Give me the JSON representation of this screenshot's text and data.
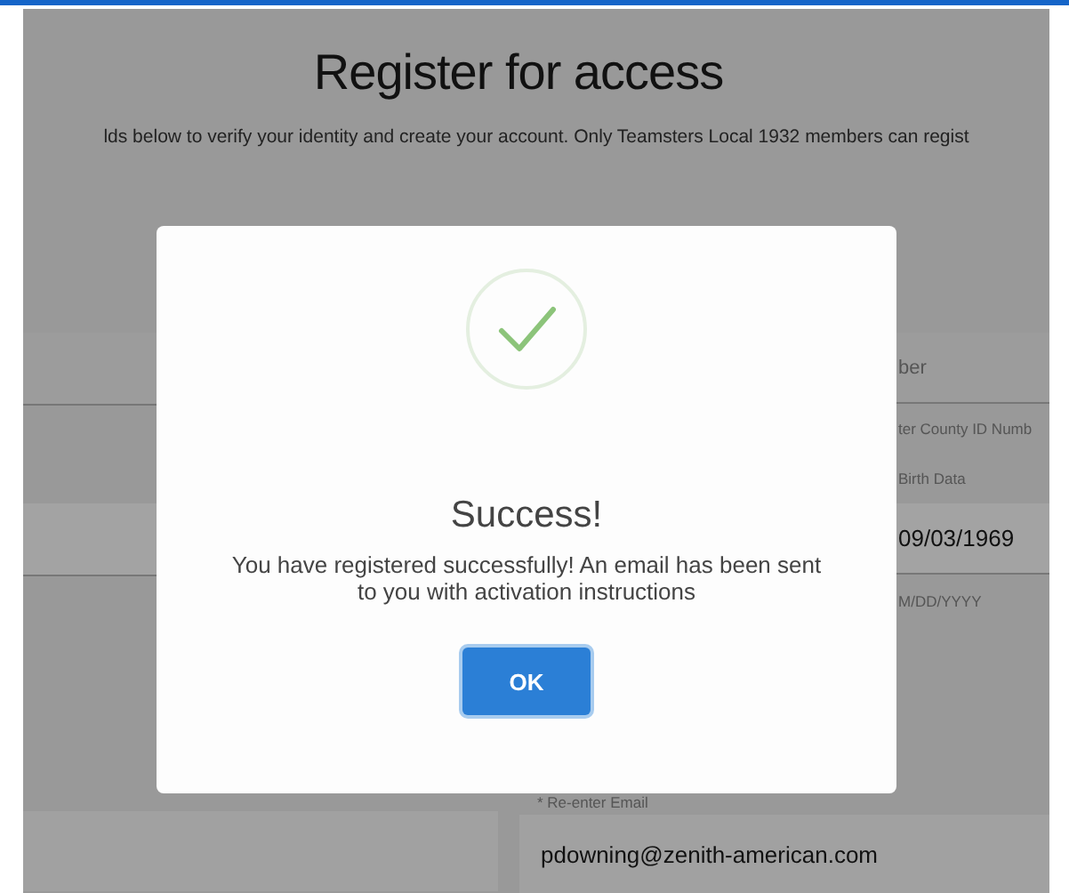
{
  "page": {
    "title": "Register for access",
    "intro": "lds below to verify your identity and create your account. Only Teamsters Local 1932 members can regist"
  },
  "form_right": {
    "section_heading": "ber",
    "hint": "ter County ID Numb",
    "birth_label": "Birth Data",
    "birth_value": "09/03/1969",
    "birth_format": "M/DD/YYYY",
    "email_label": "* Re-enter Email",
    "email_value": "pdowning@zenith-american.com"
  },
  "dialog": {
    "title": "Success!",
    "message": "You have registered successfully! An email has been sent to you with activation instructions",
    "button": "OK"
  }
}
